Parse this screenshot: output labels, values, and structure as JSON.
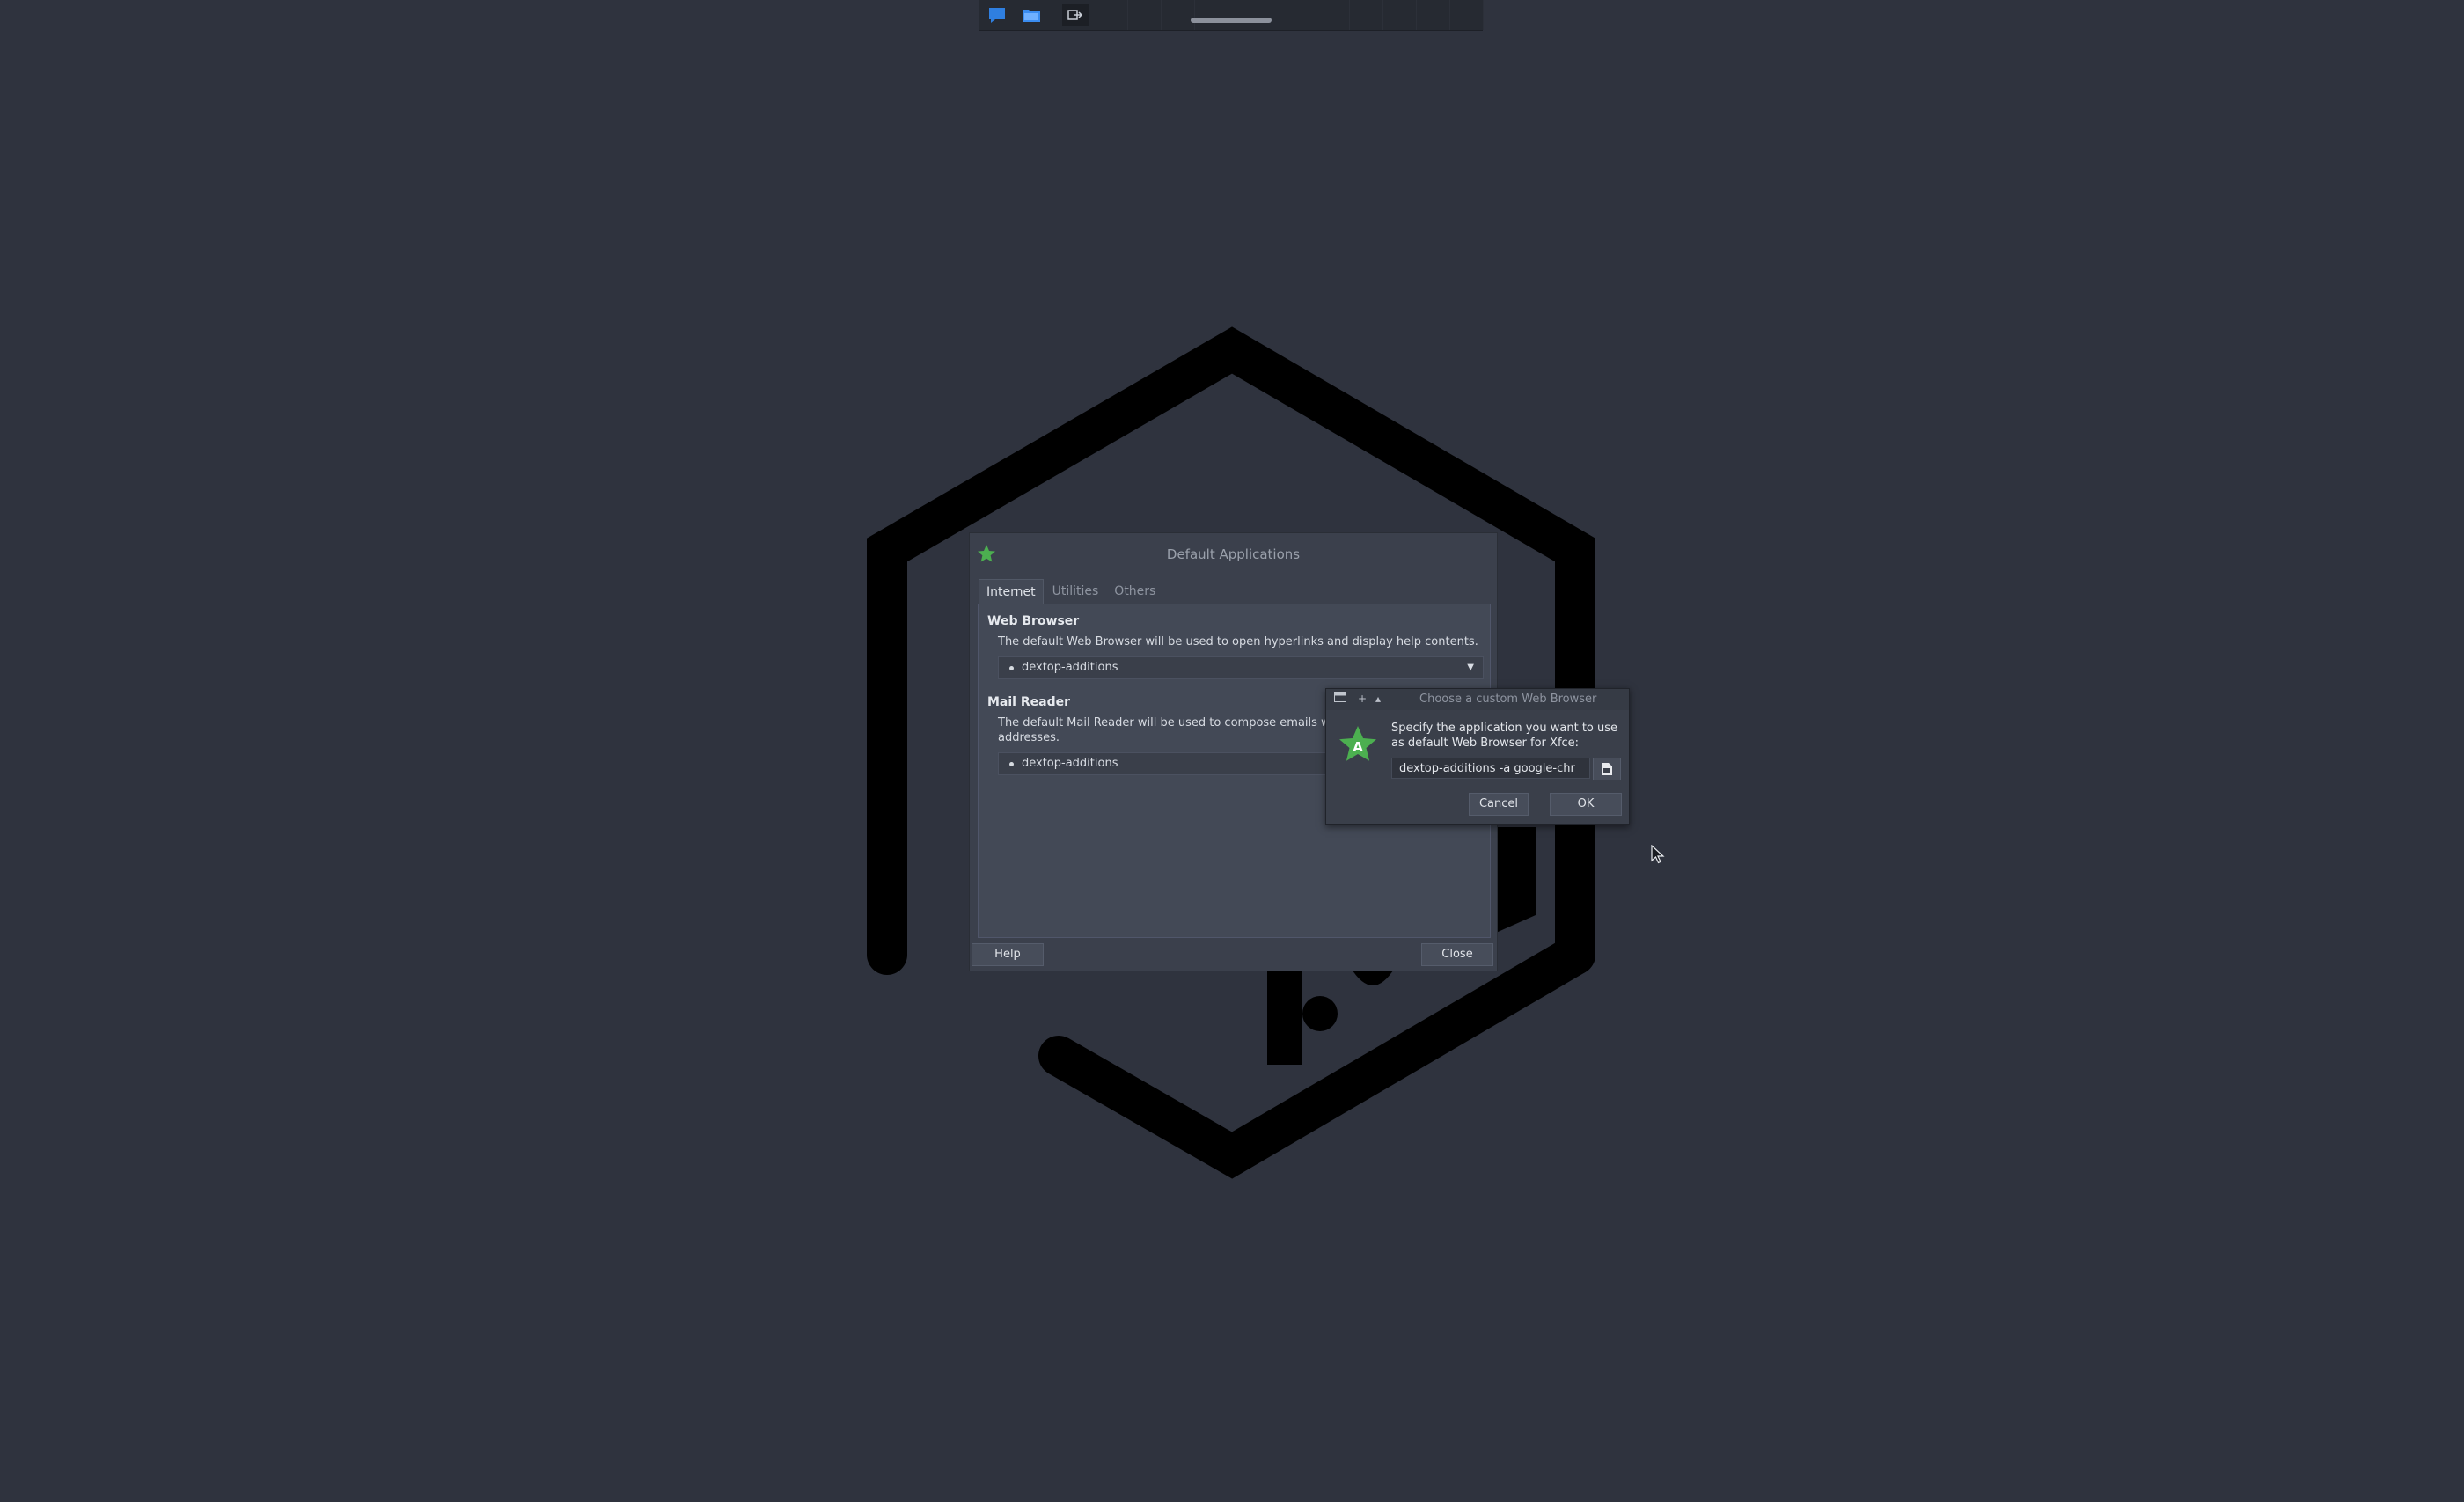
{
  "panel": {
    "launchers": [
      "terminal-icon",
      "file-manager-icon",
      "logout-icon"
    ]
  },
  "main_dialog": {
    "title": "Default Applications",
    "tabs": [
      "Internet",
      "Utilities",
      "Others"
    ],
    "active_tab": "Internet",
    "web_browser": {
      "heading": "Web Browser",
      "description": "The default Web Browser will be used to open hyperlinks and display help contents.",
      "selected": "dextop-additions"
    },
    "mail_reader": {
      "heading": "Mail Reader",
      "description_line1": "The default Mail Reader will be used to compose emails w",
      "description_line2": "addresses.",
      "selected": "dextop-additions"
    },
    "help_label": "Help",
    "close_label": "Close"
  },
  "chooser": {
    "title": "Choose a custom Web Browser",
    "prompt": "Specify the application you want to use as default Web Browser for Xfce:",
    "command_value": "dextop-additions -a google-chr",
    "cancel_label": "Cancel",
    "ok_label": "OK"
  },
  "colors": {
    "desktop": "#2f333e",
    "accent_green": "#4caf50",
    "panel_blue": "#2f7fe0"
  }
}
